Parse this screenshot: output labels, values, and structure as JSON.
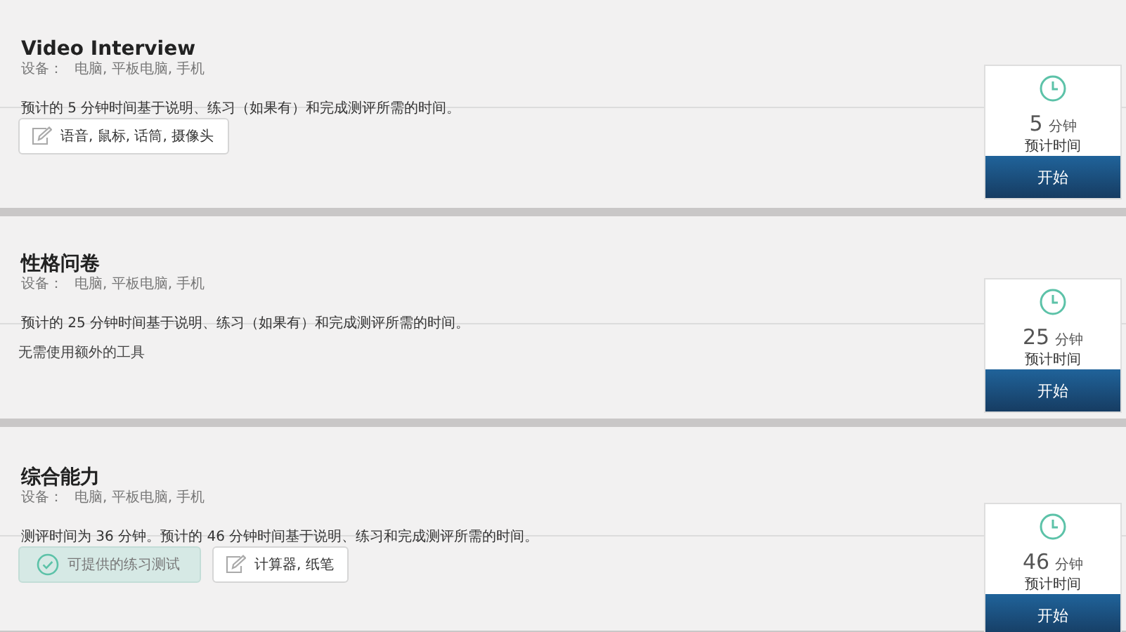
{
  "assessments": [
    {
      "title": "Video Interview",
      "devices_label": "设备：",
      "devices": "电脑, 平板电脑, 手机",
      "description": "预计的 5 分钟时间基于说明、练习（如果有）和完成测评所需的时间。",
      "footer": [
        {
          "kind": "tools",
          "text": "语音, 鼠标, 话筒, 摄像头"
        }
      ],
      "duration": "5",
      "unit": "分钟",
      "duration_label": "预计时间",
      "button": "开始"
    },
    {
      "title": "性格问卷",
      "devices_label": "设备：",
      "devices": "电脑, 平板电脑, 手机",
      "description": "预计的 25 分钟时间基于说明、练习（如果有）和完成测评所需的时间。",
      "footer": [
        {
          "kind": "note",
          "text": "无需使用额外的工具"
        }
      ],
      "duration": "25",
      "unit": "分钟",
      "duration_label": "预计时间",
      "button": "开始"
    },
    {
      "title": "综合能力",
      "devices_label": "设备：",
      "devices": "电脑, 平板电脑, 手机",
      "description": "测评时间为 36 分钟。预计的 46 分钟时间基于说明、练习和完成测评所需的时间。",
      "footer": [
        {
          "kind": "practice",
          "text": "可提供的练习测试"
        },
        {
          "kind": "tools",
          "text": "计算器, 纸笔"
        }
      ],
      "duration": "46",
      "unit": "分钟",
      "duration_label": "预计时间",
      "button": "开始"
    }
  ]
}
